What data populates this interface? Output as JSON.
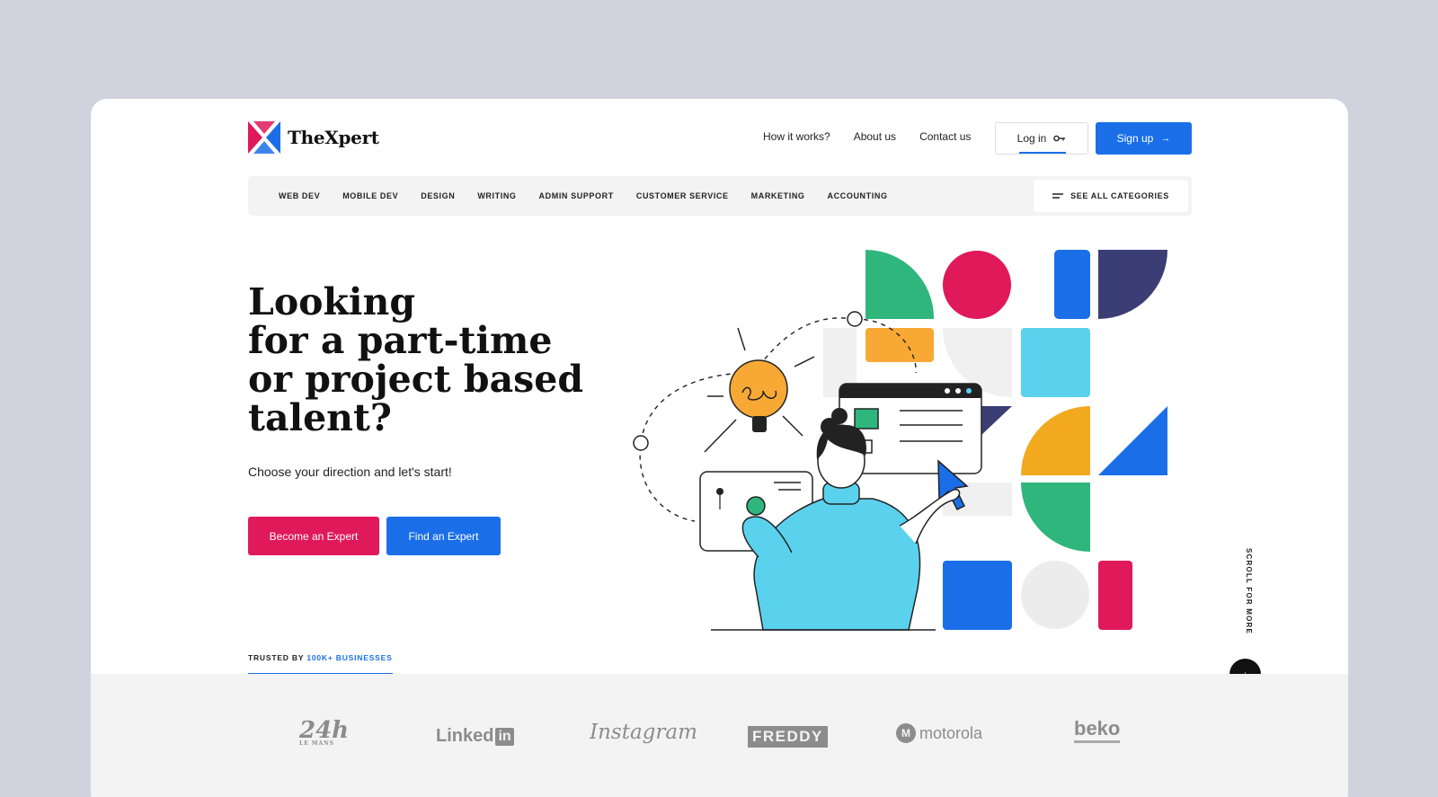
{
  "brand": {
    "name": "TheXpert",
    "accent": "#1a6fe8",
    "primary_red": "#e0195a"
  },
  "topnav": [
    {
      "label": "How it works?"
    },
    {
      "label": "About us"
    },
    {
      "label": "Contact us"
    }
  ],
  "auth": {
    "login": "Log in",
    "login_icon": "key-icon",
    "signup": "Sign up",
    "signup_icon": "arrow-right-icon"
  },
  "categories": [
    "WEB DEV",
    "MOBILE DEV",
    "DESIGN",
    "WRITING",
    "ADMIN SUPPORT",
    "CUSTOMER SERVICE",
    "MARKETING",
    "ACCOUNTING"
  ],
  "see_all": {
    "label": "SEE ALL CATEGORIES",
    "icon": "menu-lines-icon"
  },
  "hero": {
    "title_lines": [
      "Looking",
      "for a part-time",
      "or project based",
      "talent?"
    ],
    "subtitle": "Choose your direction and let's start!",
    "primary_cta": "Become an Expert",
    "secondary_cta": "Find an Expert"
  },
  "trusted": {
    "prefix": "TRUSTED BY",
    "highlight": "100K+ BUSINESSES"
  },
  "scroll": {
    "label": "SCROLL FOR MORE",
    "icon": "arrow-down-icon"
  },
  "logos": [
    {
      "name": "24h",
      "text": "24h",
      "sub": "LE MANS"
    },
    {
      "name": "linkedin",
      "text": "Linked",
      "badge": "in"
    },
    {
      "name": "instagram",
      "text": "Instagram"
    },
    {
      "name": "freddy",
      "text": "FREDDY"
    },
    {
      "name": "motorola",
      "text": "motorola",
      "mark": "M"
    },
    {
      "name": "beko",
      "text": "beko"
    }
  ]
}
